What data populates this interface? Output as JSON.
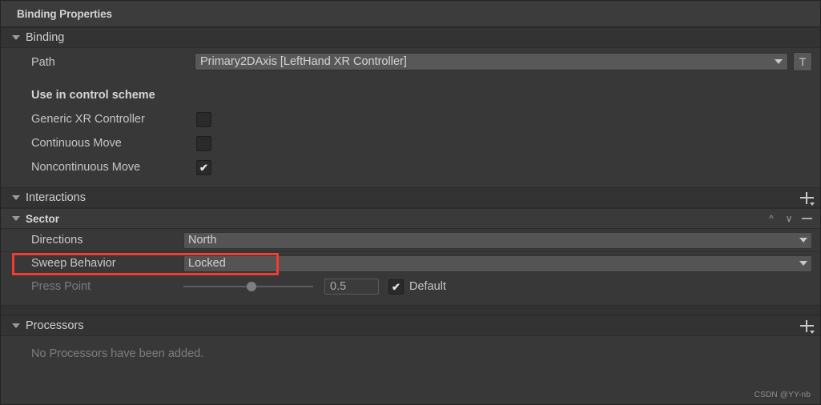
{
  "window": {
    "title": "Binding Properties"
  },
  "binding_section": {
    "title": "Binding",
    "foldout_icon": "triangle-down-icon",
    "path": {
      "label": "Path",
      "value": "Primary2DAxis [LeftHand XR Controller]",
      "dropdown_icon": "chevron-down-icon",
      "text_mode_button": "T"
    },
    "control_scheme": {
      "title": "Use in control scheme",
      "items": [
        {
          "label": "Generic XR Controller",
          "checked": false,
          "mark": ""
        },
        {
          "label": "Continuous Move",
          "checked": false,
          "mark": ""
        },
        {
          "label": "Noncontinuous Move",
          "checked": true,
          "mark": "✔"
        }
      ]
    }
  },
  "interactions_section": {
    "title": "Interactions",
    "foldout_icon": "triangle-down-icon",
    "add_button_icon": "plus-icon"
  },
  "sector_section": {
    "title": "Sector",
    "foldout_icon": "triangle-down-icon",
    "move_up_icon": "chevron-up-icon",
    "move_down_icon": "chevron-down-icon",
    "remove_icon": "minus-icon",
    "rows": {
      "directions": {
        "label": "Directions",
        "value": "North",
        "dropdown_icon": "chevron-down-icon",
        "highlighted": true
      },
      "sweep_behavior": {
        "label": "Sweep Behavior",
        "value": "Locked",
        "dropdown_icon": "chevron-down-icon"
      },
      "press_point": {
        "label": "Press Point",
        "value": "0.5",
        "slider_percent": 50,
        "default_label": "Default",
        "default_checked": true,
        "default_mark": "✔",
        "disabled": true
      }
    }
  },
  "processors_section": {
    "title": "Processors",
    "foldout_icon": "triangle-down-icon",
    "add_button_icon": "plus-icon",
    "empty_text": "No Processors have been added."
  },
  "watermark": {
    "text": "CSDN @YY-nb"
  },
  "colors": {
    "panel_bg": "#383838",
    "header_bg": "#333333",
    "field_bg": "#545454",
    "highlight": "#f33b33",
    "text": "#c8c8c8",
    "text_dim": "#7d7d7d"
  }
}
